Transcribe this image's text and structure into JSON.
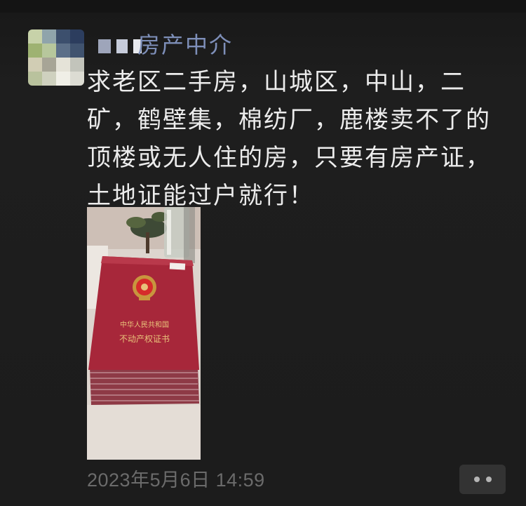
{
  "post": {
    "author_name_visible": "房产中介",
    "text_lines": [
      "求老区二手房，山城区，中山，二",
      "矿，鹤壁集，棉纺厂，鹿楼卖不了的",
      "顶楼或无人住的房，只要有房产证，",
      "土地证能过户就行！"
    ],
    "photo": {
      "certificate_line1": "中华人民共和国",
      "certificate_line2": "不动产权证书"
    },
    "timestamp": "2023年5月6日 14:59"
  },
  "icons": {
    "more": "more-dots-icon",
    "emblem": "national-emblem-icon"
  },
  "colors": {
    "background": "#1c1c1c",
    "nickname": "#7e8fb9",
    "text": "#ececec",
    "timestamp": "#6b6b6b",
    "certificate_red": "#a7273a",
    "certificate_gold": "#e8c27a"
  }
}
